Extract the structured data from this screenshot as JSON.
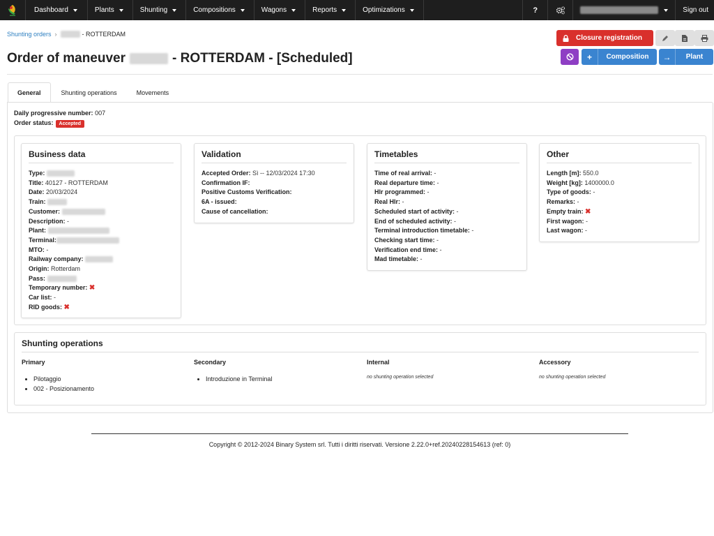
{
  "nav": {
    "items": [
      {
        "label": "Dashboard"
      },
      {
        "label": "Plants"
      },
      {
        "label": "Shunting"
      },
      {
        "label": "Compositions"
      },
      {
        "label": "Wagons"
      },
      {
        "label": "Reports"
      },
      {
        "label": "Optimizations"
      }
    ],
    "help": "?",
    "settings_icon": "gears-icon",
    "signout": "Sign out"
  },
  "breadcrumb": {
    "parent": "Shunting orders",
    "current_suffix": "- ROTTERDAM"
  },
  "title": {
    "prefix": "Order of maneuver",
    "suffix": "- ROTTERDAM - [Scheduled]"
  },
  "actions": {
    "closure": "Closure registration",
    "composition": "Composition",
    "plant": "Plant"
  },
  "tabs": [
    {
      "label": "General"
    },
    {
      "label": "Shunting operations"
    },
    {
      "label": "Movements"
    }
  ],
  "general": {
    "progressive_label": "Daily progressive number:",
    "progressive_value": "007",
    "status_label": "Order status:",
    "status_value": "Accepted",
    "status_color": "#d9302c"
  },
  "business": {
    "title": "Business data",
    "type_label": "Type:",
    "title_label": "Title:",
    "title_value": "40127 - ROTTERDAM",
    "date_label": "Date:",
    "date_value": "20/03/2024",
    "train_label": "Train:",
    "customer_label": "Customer:",
    "description_label": "Description:",
    "description_value": "-",
    "plant_label": "Plant:",
    "terminal_label": "Terminal:",
    "mto_label": "MTO:",
    "mto_value": "-",
    "railway_label": "Railway company:",
    "origin_label": "Origin:",
    "origin_value": "Rotterdam",
    "pass_label": "Pass:",
    "temp_label": "Temporary number:",
    "carlist_label": "Car list:",
    "carlist_value": "-",
    "rid_label": "RID goods:"
  },
  "validation": {
    "title": "Validation",
    "accepted_label": "Accepted Order:",
    "accepted_value": "Sì -- 12/03/2024 17:30",
    "confirmation_label": "Confirmation IF:",
    "customs_label": "Positive Customs Verification:",
    "sixa_label": "6A - issued:",
    "cancel_label": "Cause of cancellation:"
  },
  "timetables": {
    "title": "Timetables",
    "rows": [
      {
        "label": "Time of real arrival:",
        "value": "-"
      },
      {
        "label": "Real departure time:",
        "value": "-"
      },
      {
        "label": "Hlr programmed:",
        "value": "-"
      },
      {
        "label": "Real Hlr:",
        "value": "-"
      },
      {
        "label": "Scheduled start of activity:",
        "value": "-"
      },
      {
        "label": "End of scheduled activity:",
        "value": "-"
      },
      {
        "label": "Terminal introduction timetable:",
        "value": "-"
      },
      {
        "label": "Checking start time:",
        "value": "-"
      },
      {
        "label": "Verification end time:",
        "value": "-"
      },
      {
        "label": "Mad timetable:",
        "value": "-"
      }
    ]
  },
  "other": {
    "title": "Other",
    "length_label": "Length [m]:",
    "length_value": "550.0",
    "weight_label": "Weight [kg]:",
    "weight_value": "1400000.0",
    "goods_label": "Type of goods:",
    "goods_value": "-",
    "remarks_label": "Remarks:",
    "remarks_value": "-",
    "empty_label": "Empty train:",
    "first_label": "First wagon:",
    "first_value": "-",
    "last_label": "Last wagon:",
    "last_value": "-"
  },
  "shunting": {
    "title": "Shunting operations",
    "primary": {
      "label": "Primary",
      "items": [
        "Pilotaggio",
        "002 - Posizionamento"
      ]
    },
    "secondary": {
      "label": "Secondary",
      "items": [
        "Introduzione in Terminal"
      ]
    },
    "internal": {
      "label": "Internal",
      "empty": "no shunting operation selected"
    },
    "accessory": {
      "label": "Accessory",
      "empty": "no shunting operation selected"
    }
  },
  "footer": {
    "text": "Copyright © 2012-2024 Binary System srl. Tutti i diritti riservati. Versione 2.22.0+ref.20240228154613 (ref: 0)"
  }
}
